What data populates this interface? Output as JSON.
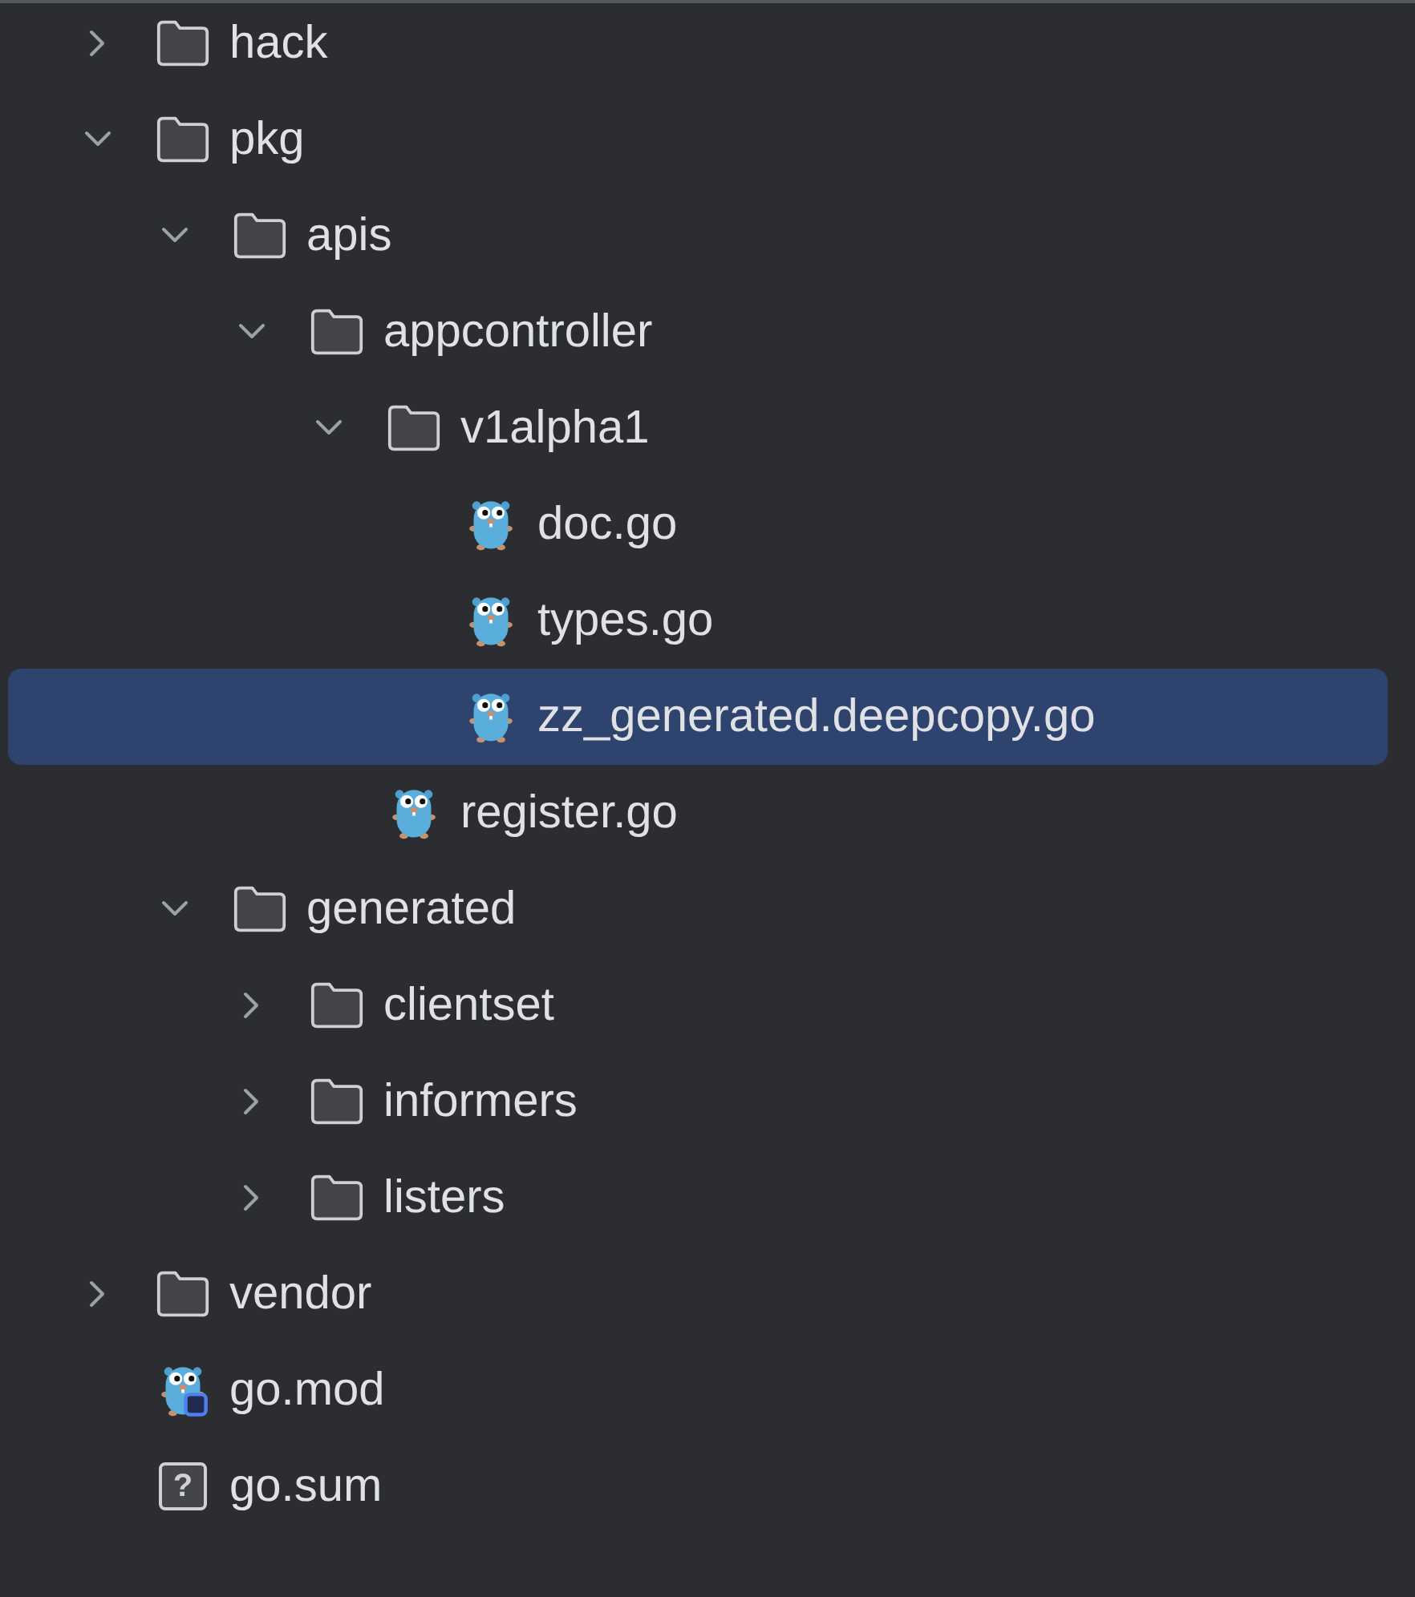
{
  "tree": [
    {
      "name": "hack",
      "kind": "folder",
      "expanded": false,
      "selected": false
    },
    {
      "name": "pkg",
      "kind": "folder",
      "expanded": true,
      "selected": false,
      "children": [
        {
          "name": "apis",
          "kind": "folder",
          "expanded": true,
          "selected": false,
          "children": [
            {
              "name": "appcontroller",
              "kind": "folder",
              "expanded": true,
              "selected": false,
              "children": [
                {
                  "name": "v1alpha1",
                  "kind": "folder",
                  "expanded": true,
                  "selected": false,
                  "children": [
                    {
                      "name": "doc.go",
                      "kind": "go",
                      "selected": false
                    },
                    {
                      "name": "types.go",
                      "kind": "go",
                      "selected": false
                    },
                    {
                      "name": "zz_generated.deepcopy.go",
                      "kind": "go",
                      "selected": true
                    }
                  ]
                },
                {
                  "name": "register.go",
                  "kind": "go",
                  "selected": false
                }
              ]
            }
          ]
        },
        {
          "name": "generated",
          "kind": "folder",
          "expanded": true,
          "selected": false,
          "children": [
            {
              "name": "clientset",
              "kind": "folder",
              "expanded": false,
              "selected": false
            },
            {
              "name": "informers",
              "kind": "folder",
              "expanded": false,
              "selected": false
            },
            {
              "name": "listers",
              "kind": "folder",
              "expanded": false,
              "selected": false
            }
          ]
        }
      ]
    },
    {
      "name": "vendor",
      "kind": "folder",
      "expanded": false,
      "selected": false
    },
    {
      "name": "go.mod",
      "kind": "gomod",
      "selected": false
    },
    {
      "name": "go.sum",
      "kind": "unknown",
      "glyph": "?",
      "selected": false
    }
  ]
}
